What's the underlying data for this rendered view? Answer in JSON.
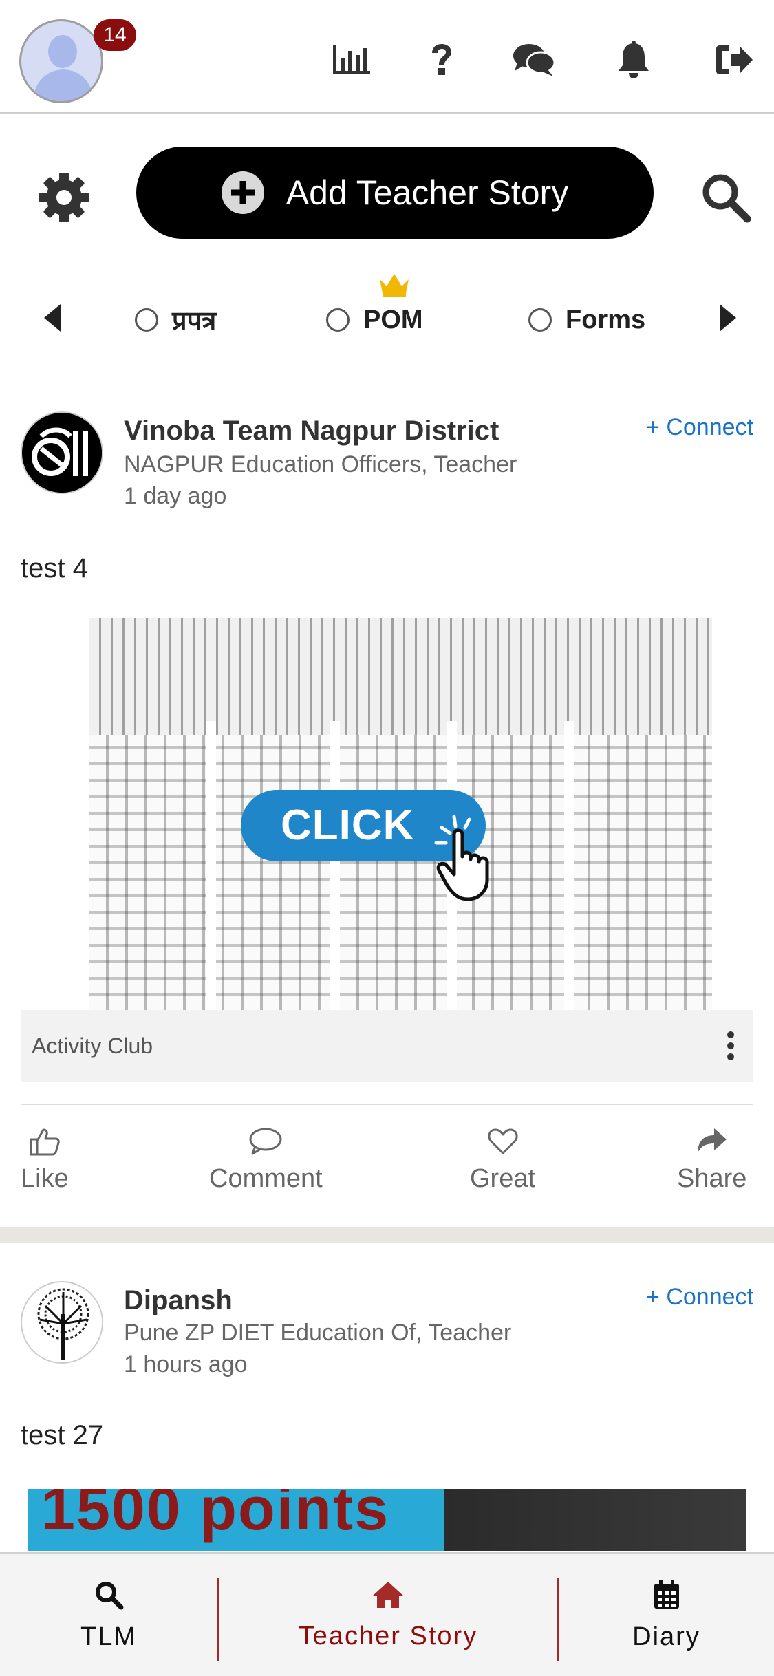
{
  "header": {
    "notification_count": "14",
    "icons": [
      "bar-chart-icon",
      "help-icon",
      "chat-icon",
      "bell-icon",
      "logout-icon"
    ]
  },
  "actions": {
    "add_story_label": "Add Teacher Story"
  },
  "filters": {
    "items": [
      {
        "label": "प्रपत्र",
        "selected": false
      },
      {
        "label": "POM",
        "selected": false,
        "featured": true
      },
      {
        "label": "Forms",
        "selected": false
      }
    ]
  },
  "posts": [
    {
      "author": "Vinoba Team Nagpur District",
      "role": "NAGPUR Education Officers, Teacher",
      "time": "1 day ago",
      "connect_label": "+ Connect",
      "text": "test 4",
      "image_text": "CLICK",
      "club": "Activity Club"
    },
    {
      "author": "Dipansh",
      "role": "Pune ZP DIET Education Of, Teacher",
      "time": "1 hours ago",
      "connect_label": "+ Connect",
      "text": "test 27",
      "image_text": "1500 points"
    }
  ],
  "reactions": {
    "like": "Like",
    "comment": "Comment",
    "great": "Great",
    "share": "Share"
  },
  "bottom_nav": {
    "items": [
      {
        "label": "TLM",
        "icon": "search-icon",
        "active": false
      },
      {
        "label": "Teacher Story",
        "icon": "home-icon",
        "active": true
      },
      {
        "label": "Diary",
        "icon": "calendar-icon",
        "active": false
      }
    ]
  },
  "colors": {
    "active": "#8b0d0d",
    "link": "#1a73c9",
    "badge": "#8b0d0d",
    "primary_button": "#000000"
  }
}
